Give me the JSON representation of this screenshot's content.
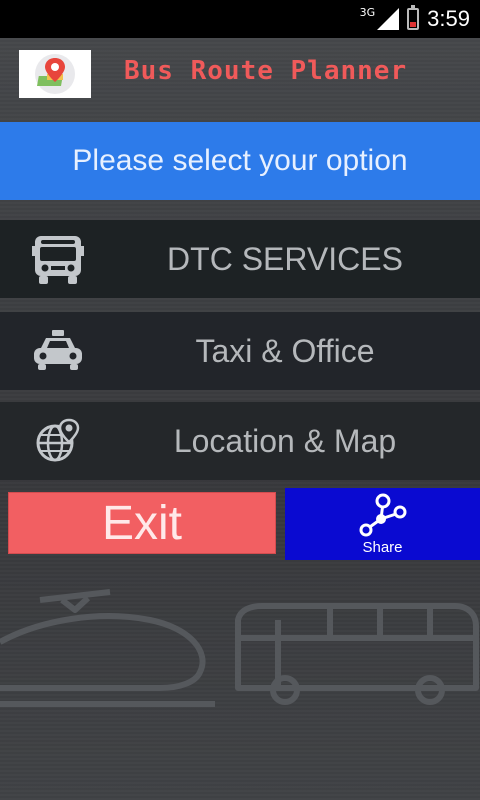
{
  "status_bar": {
    "network": "3G",
    "time": "3:59"
  },
  "header": {
    "title": "Bus Route Planner",
    "logo_icon": "map-pin-icon"
  },
  "banner": {
    "text": "Please select your option"
  },
  "menu": {
    "items": [
      {
        "label": "DTC SERVICES",
        "icon": "bus-icon"
      },
      {
        "label": "Taxi & Office",
        "icon": "taxi-icon"
      },
      {
        "label": "Location & Map",
        "icon": "globe-pin-icon"
      }
    ]
  },
  "actions": {
    "exit_label": "Exit",
    "share_label": "Share",
    "share_icon": "share-icon"
  },
  "colors": {
    "banner": "#2d7bea",
    "title": "#f05a5a",
    "exit": "#f25f62",
    "share": "#0a0ad1"
  }
}
